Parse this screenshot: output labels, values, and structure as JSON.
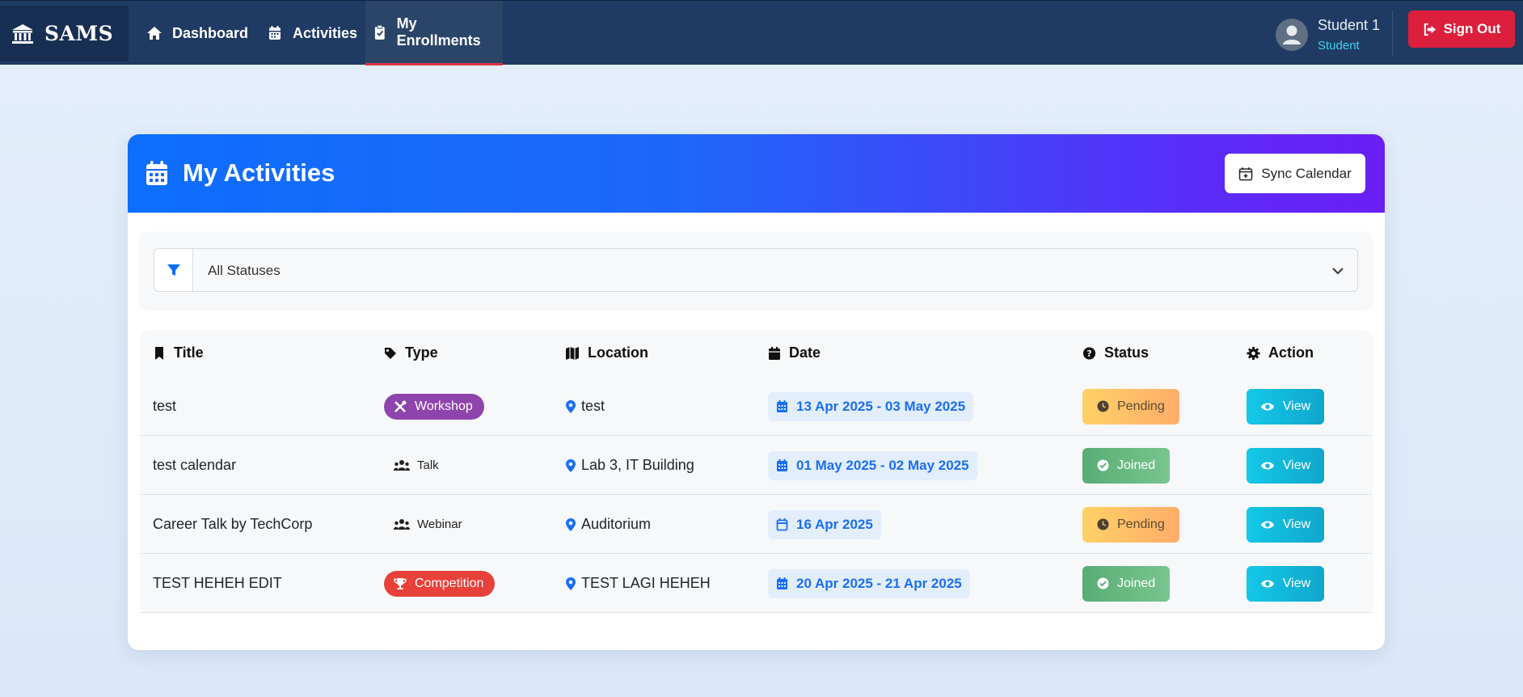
{
  "app": {
    "brand": "SAMS"
  },
  "nav": {
    "items": [
      {
        "label": "Dashboard",
        "icon": "home-icon"
      },
      {
        "label": "Activities",
        "icon": "calendar-icon"
      },
      {
        "label": "My Enrollments",
        "icon": "clipboard-check-icon",
        "active": true
      }
    ],
    "user": {
      "name": "Student 1",
      "role": "Student"
    },
    "signout_label": "Sign Out"
  },
  "page": {
    "title": "My Activities",
    "sync_label": "Sync Calendar",
    "filter": {
      "value": "All Statuses"
    }
  },
  "table": {
    "headers": {
      "title": "Title",
      "type": "Type",
      "location": "Location",
      "date": "Date",
      "status": "Status",
      "action": "Action"
    },
    "rows": [
      {
        "title": "test",
        "type": "Workshop",
        "type_style": "workshop",
        "location": "test",
        "date": "13 Apr 2025 - 03 May 2025",
        "date_icon": "calendar-alt-icon",
        "status": "Pending",
        "action": "View"
      },
      {
        "title": "test calendar",
        "type": "Talk",
        "type_style": "plain",
        "location": "Lab 3, IT Building",
        "date": "01 May 2025 - 02 May 2025",
        "date_icon": "calendar-alt-icon",
        "status": "Joined",
        "action": "View"
      },
      {
        "title": "Career Talk by TechCorp",
        "type": "Webinar",
        "type_style": "plain",
        "location": "Auditorium",
        "date": "16 Apr 2025",
        "date_icon": "calendar-icon",
        "status": "Pending",
        "action": "View"
      },
      {
        "title": "TEST HEHEH EDIT",
        "type": "Competition",
        "type_style": "competition",
        "location": "TEST LAGI HEHEH",
        "date": "20 Apr 2025 - 21 Apr 2025",
        "date_icon": "calendar-alt-icon",
        "status": "Joined",
        "action": "View"
      }
    ]
  },
  "colors": {
    "navbar": "#1f3b63",
    "accent": "#0d6efd",
    "signout": "#dc1f3c",
    "workshop": "#8e44ad",
    "competition": "#e8413a",
    "view": "#14c8e8"
  }
}
